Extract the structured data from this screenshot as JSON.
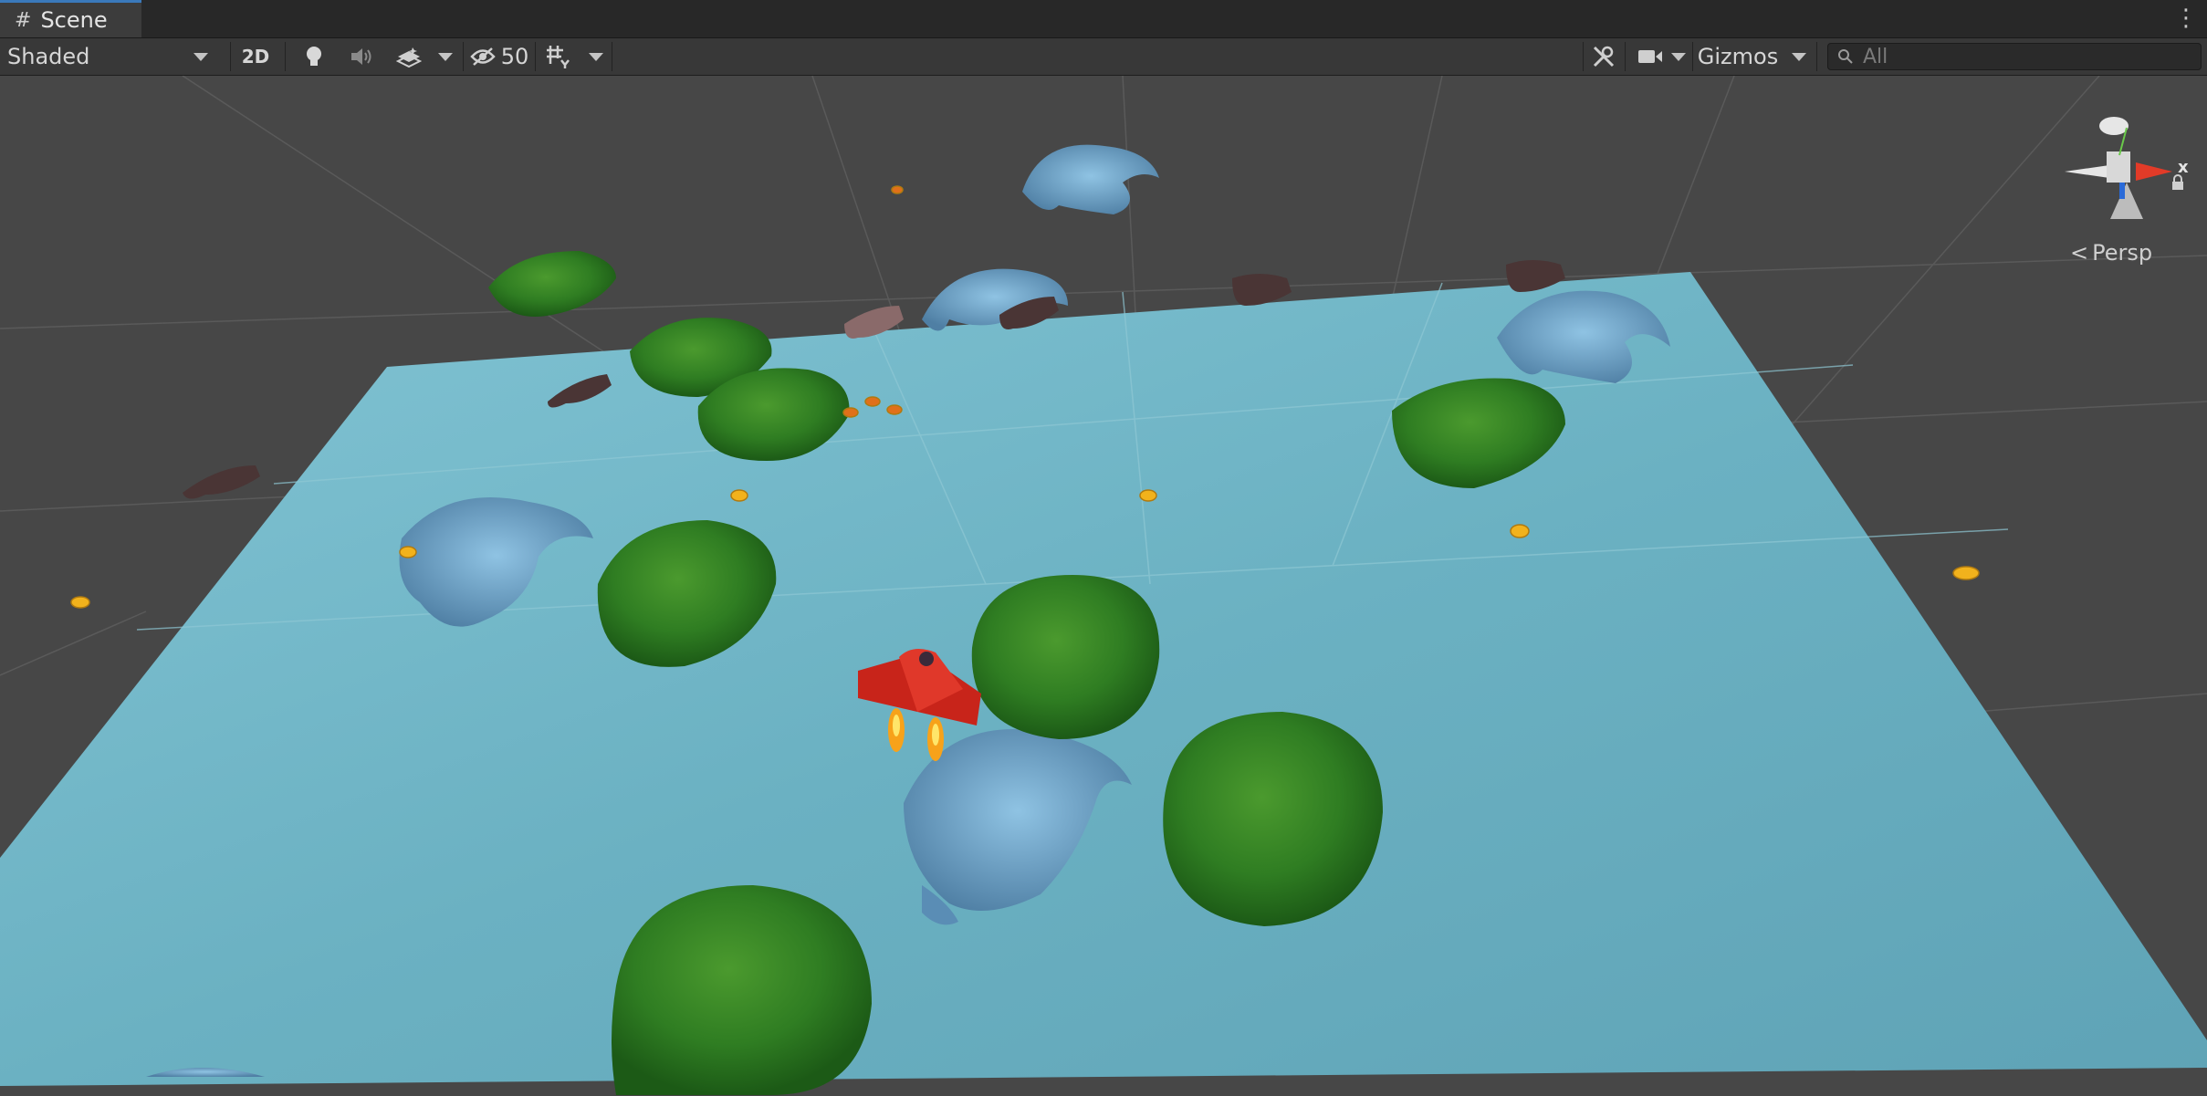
{
  "tab": {
    "label": "Scene"
  },
  "toolbar": {
    "shading_mode": "Shaded",
    "toggle_2d": "2D",
    "hidden_count": "50",
    "gizmos_label": "Gizmos",
    "search_placeholder": "All"
  },
  "gizmo": {
    "projection_label": "Persp",
    "axis_x": "x"
  },
  "colors": {
    "background": "#3c3c3c",
    "ground": "#6fb6c6",
    "tree": "#2f7d22",
    "rock": "#6b9ec5",
    "player": "#c8241a",
    "coin": "#f2b21c",
    "tab_accent": "#3a79bb"
  }
}
